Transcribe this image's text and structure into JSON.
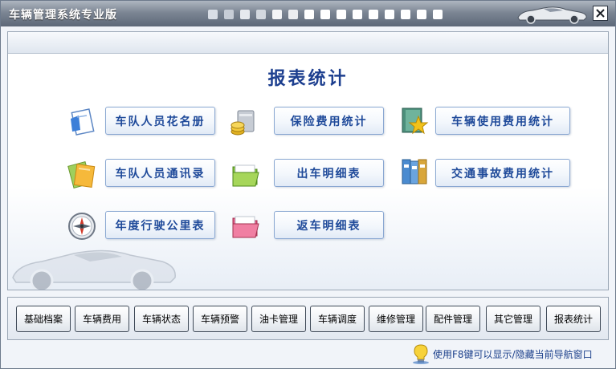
{
  "window": {
    "title": "车辆管理系统专业版",
    "title_dot_colors": [
      "#d9dee6",
      "#c7cdd6",
      "#e6e9ee",
      "#d3d8df",
      "#f4f5f7",
      "#eceef1",
      "#ffffff",
      "#ffffff",
      "#ffffff",
      "#ffffff",
      "#ffffff",
      "#ffffff",
      "#ffffff",
      "#ffffff",
      "#ffffff"
    ],
    "close_icon": "close-icon"
  },
  "panel": {
    "title": "报表统计",
    "reports": [
      {
        "label": "车队人员花名册",
        "icon": "document-icon"
      },
      {
        "label": "保险费用统计",
        "icon": "coins-icon"
      },
      {
        "label": "车辆使用费用统计",
        "icon": "star-book-icon"
      },
      {
        "label": "车队人员通讯录",
        "icon": "notebook-icon"
      },
      {
        "label": "出车明细表",
        "icon": "green-folder-icon"
      },
      {
        "label": "交通事故费用统计",
        "icon": "binders-icon"
      },
      {
        "label": "年度行驶公里表",
        "icon": "compass-icon"
      },
      {
        "label": "返车明细表",
        "icon": "pink-folder-icon"
      }
    ]
  },
  "nav": {
    "buttons": [
      "基础档案",
      "车辆费用",
      "车辆状态",
      "车辆预警",
      "油卡管理",
      "车辆调度",
      "维修管理",
      "配件管理",
      "其它管理",
      "报表统计"
    ]
  },
  "hint": {
    "text": "使用F8键可以显示/隐藏当前导航窗口",
    "icon": "lightbulb-icon"
  },
  "colors": {
    "title_blue": "#1d3f8f",
    "button_text_blue": "#1f4a9a",
    "button_border": "#8aa8d2"
  }
}
